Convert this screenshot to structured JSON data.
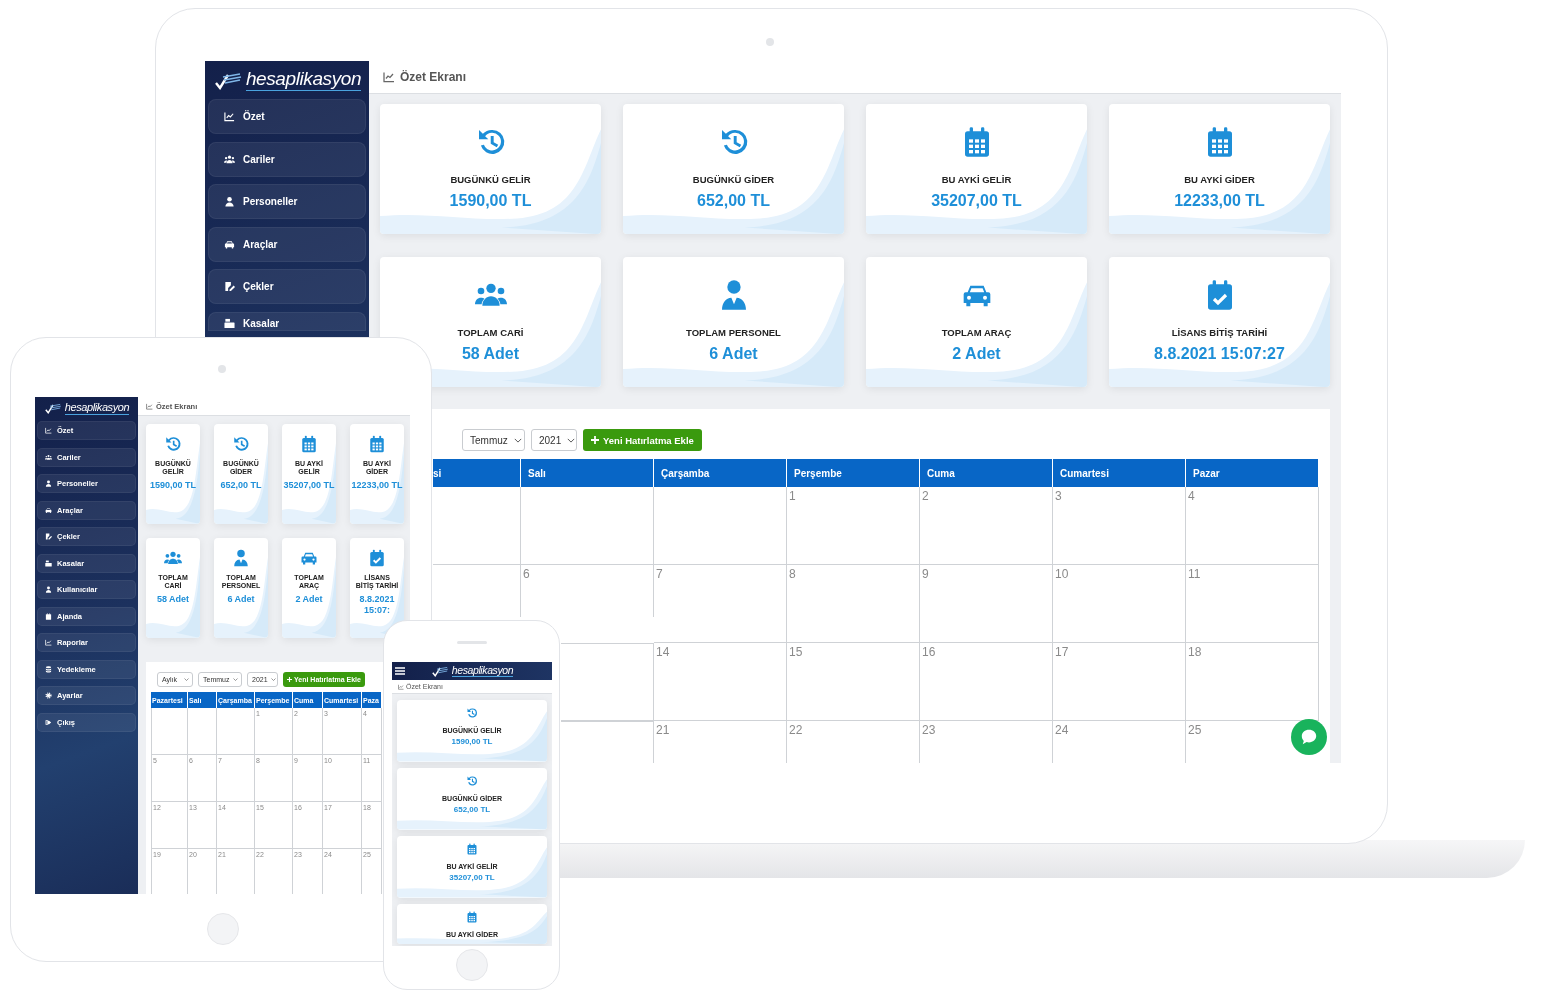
{
  "laptop": {
    "brand": "hesaplikasyon",
    "page_title": "Özet Ekranı",
    "menu": [
      {
        "label": "Özet"
      },
      {
        "label": "Cariler"
      },
      {
        "label": "Personeller"
      },
      {
        "label": "Araçlar"
      },
      {
        "label": "Çekler"
      },
      {
        "label": "Kasalar"
      }
    ],
    "cards": [
      {
        "label": "BUGÜNKÜ GELİR",
        "value": "1590,00 TL"
      },
      {
        "label": "BUGÜNKÜ GİDER",
        "value": "652,00 TL"
      },
      {
        "label": "BU AYKİ GELİR",
        "value": "35207,00 TL"
      },
      {
        "label": "BU AYKİ GİDER",
        "value": "12233,00 TL"
      },
      {
        "label": "TOPLAM CARİ",
        "value": "58 Adet"
      },
      {
        "label": "TOPLAM PERSONEL",
        "value": "6 Adet"
      },
      {
        "label": "TOPLAM ARAÇ",
        "value": "2 Adet"
      },
      {
        "label": "LİSANS BİTİŞ TARİHİ",
        "value": "8.8.2021 15:07:27"
      }
    ],
    "calendar": {
      "controls": [
        {
          "kind": "select",
          "value": "Temmuz"
        },
        {
          "kind": "select",
          "value": "2021"
        },
        {
          "kind": "button",
          "label": "Yeni Hatırlatma Ekle"
        }
      ],
      "columns": [
        "si",
        "Salı",
        "Çarşamba",
        "Perşembe",
        "Cuma",
        "Cumartesi",
        "Pazar"
      ],
      "weeks": [
        [
          "1",
          "2",
          "3",
          "4"
        ],
        [
          "6",
          "7",
          "8",
          "9",
          "10",
          "11"
        ],
        [
          "14",
          "15",
          "16",
          "17",
          "18"
        ],
        [
          "21",
          "22",
          "23",
          "24",
          "25"
        ]
      ]
    }
  },
  "tablet": {
    "brand": "hesaplikasyon",
    "page_title": "Özet Ekranı",
    "menu": [
      {
        "label": "Özet"
      },
      {
        "label": "Cariler"
      },
      {
        "label": "Personeller"
      },
      {
        "label": "Araçlar"
      },
      {
        "label": "Çekler"
      },
      {
        "label": "Kasalar"
      },
      {
        "label": "Kullanıcılar"
      },
      {
        "label": "Ajanda"
      },
      {
        "label": "Raporlar"
      },
      {
        "label": "Yedekleme"
      },
      {
        "label": "Ayarlar"
      },
      {
        "label": "Çıkış"
      }
    ],
    "cards": [
      {
        "label": "BUGÜNKÜ GELİR",
        "value": "1590,00 TL"
      },
      {
        "label": "BUGÜNKÜ GİDER",
        "value": "652,00 TL"
      },
      {
        "label": "BU AYKİ GELİR",
        "value": "35207,00 TL"
      },
      {
        "label": "BU AYKİ GİDER",
        "value": "12233,00 TL"
      },
      {
        "label": "TOPLAM CARİ",
        "value": "58 Adet"
      },
      {
        "label": "TOPLAM PERSONEL",
        "value": "6 Adet"
      },
      {
        "label": "TOPLAM ARAÇ",
        "value": "2 Adet"
      },
      {
        "label": "LİSANS BİTİŞ TARİHİ",
        "value": "8.8.2021 15:07:"
      }
    ],
    "calendar": {
      "controls": [
        {
          "kind": "select",
          "value": "Aylık"
        },
        {
          "kind": "select",
          "value": "Temmuz"
        },
        {
          "kind": "select",
          "value": "2021"
        },
        {
          "kind": "button",
          "label": "Yeni Hatırlatma Ekle"
        }
      ],
      "columns": [
        "Pazartesi",
        "Salı",
        "Çarşamba",
        "Perşembe",
        "Cuma",
        "Cumartesi",
        "Paza"
      ],
      "weeks": [
        [
          "1",
          "2",
          "3",
          "4"
        ],
        [
          "5",
          "6",
          "7",
          "8",
          "9",
          "10",
          "11"
        ],
        [
          "12",
          "13",
          "14",
          "15",
          "16",
          "17",
          "18"
        ],
        [
          "19",
          "20",
          "21",
          "22",
          "23",
          "24",
          "25"
        ]
      ]
    }
  },
  "phone": {
    "brand": "hesaplikasyon",
    "page_title": "Özet Ekranı",
    "cards": [
      {
        "label": "BUGÜNKÜ GELİR",
        "value": "1590,00 TL"
      },
      {
        "label": "BUGÜNKÜ GİDER",
        "value": "652,00 TL"
      },
      {
        "label": "BU AYKİ GELİR",
        "value": "35207,00 TL"
      },
      {
        "label": "BU AYKİ GİDER"
      }
    ]
  }
}
